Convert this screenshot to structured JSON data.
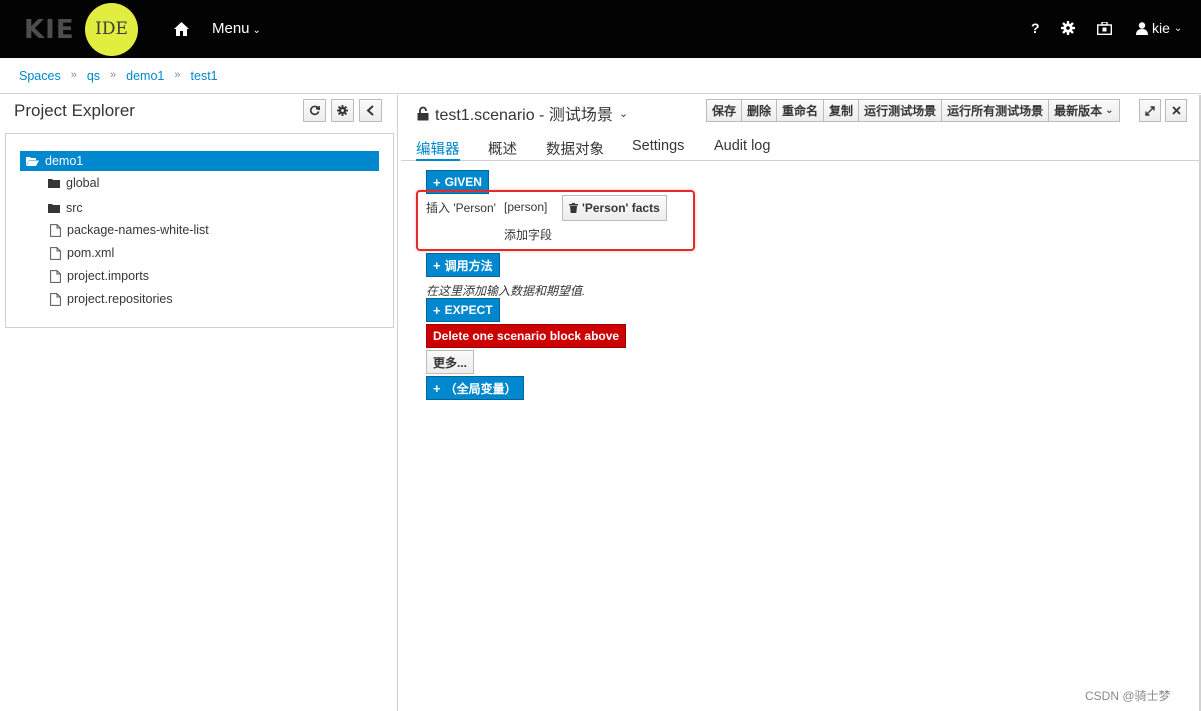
{
  "navbar": {
    "brand": "KIE",
    "brand_badge": "IDE",
    "brand_badge_color": "#e2ee3f",
    "menu_label": "Menu",
    "help_label": "?",
    "user_label": "kie"
  },
  "breadcrumb": [
    "Spaces",
    "qs",
    "demo1",
    "test1"
  ],
  "project_explorer": {
    "title": "Project Explorer",
    "tree": [
      {
        "label": "demo1",
        "icon": "folder-open-icon",
        "selected": true
      },
      {
        "label": "global",
        "icon": "folder-icon"
      },
      {
        "label": "src",
        "icon": "folder-icon"
      },
      {
        "label": "package-names-white-list",
        "icon": "file-icon"
      },
      {
        "label": "pom.xml",
        "icon": "file-icon"
      },
      {
        "label": "project.imports",
        "icon": "file-icon"
      },
      {
        "label": "project.repositories",
        "icon": "file-icon"
      }
    ]
  },
  "editor": {
    "title": "test1.scenario - 测试场景",
    "actions": [
      "保存",
      "删除",
      "重命名",
      "复制",
      "运行测试场景",
      "运行所有测试场景",
      "最新版本"
    ],
    "tabs": [
      "编辑器",
      "概述",
      "数据对象",
      "Settings",
      "Audit log"
    ],
    "active_tab": "编辑器"
  },
  "scenario": {
    "given_btn": "GIVEN",
    "insert_label": "插入 'Person'",
    "fact_var": "[person]",
    "facts_btn": "'Person' facts",
    "add_field": "添加字段",
    "call_method_btn": "调用方法",
    "hint": "在这里添加输入数据和期望值.",
    "expect_btn": "EXPECT",
    "delete_btn": "Delete one scenario block above",
    "more_btn": "更多...",
    "global_btn": "（全局变量）"
  },
  "watermark": "CSDN @骑士梦",
  "colors": {
    "accent": "#0088ce",
    "danger": "#cc0000",
    "highlight": "#e32b2b"
  }
}
